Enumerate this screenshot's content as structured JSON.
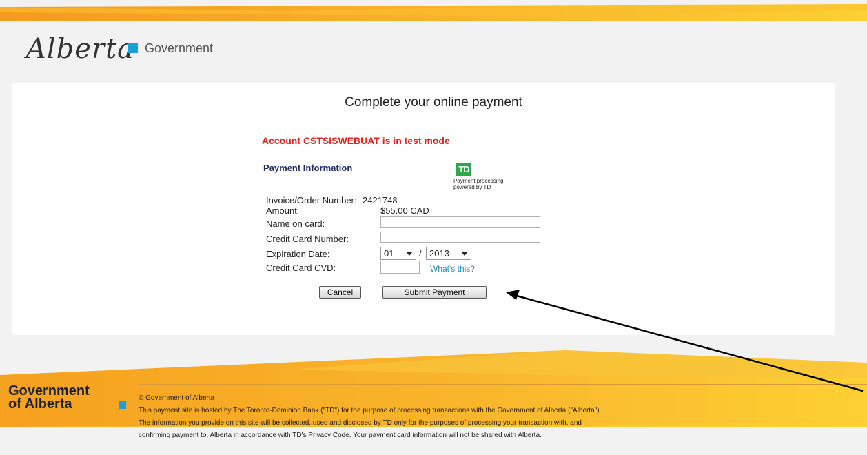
{
  "header": {
    "logo_script": "Alberta",
    "logo_gov": "Government"
  },
  "page": {
    "title": "Complete your online payment",
    "test_mode": "Account CSTSISWEBUAT is in test mode",
    "payment_info_heading": "Payment Information",
    "td": {
      "logo_text": "TD",
      "caption": "Payment processing powered by TD"
    }
  },
  "form": {
    "invoice_label": "Invoice/Order Number:",
    "invoice_value": "2421748",
    "amount_label": "Amount:",
    "amount_value": "$55.00 CAD",
    "name_label": "Name on card:",
    "name_value": "",
    "cc_label": "Credit Card Number:",
    "cc_value": "",
    "exp_label": "Expiration Date:",
    "exp_month": "01",
    "exp_separator": "/",
    "exp_year": "2013",
    "cvd_label": "Credit Card CVD:",
    "cvd_value": "",
    "whats_this": "What's this?",
    "cancel_label": "Cancel",
    "submit_label": "Submit Payment"
  },
  "footer": {
    "gov_line1": "Government",
    "gov_line2": "of Alberta",
    "copyright": "© Government of Alberta",
    "line1": "This payment site is hosted by The Toronto-Dominion Bank (\"TD\") for the purpose of processing transactions with the Government of Alberta (\"Alberta\").",
    "line2": "The information you provide on this site will be collected, used and disclosed by TD only for the purposes of processing your transaction with, and",
    "line3": "confirming payment to, Alberta in accordance with  TD's Privacy Code. Your payment card information will not be shared with Alberta."
  },
  "colors": {
    "accent_blue": "#1aa0d8",
    "warning_red": "#e8211a",
    "heading_navy": "#1f2b6b",
    "td_green": "#2aa84a",
    "band_orange": "#f7a823",
    "band_yellow": "#fcd12a"
  }
}
